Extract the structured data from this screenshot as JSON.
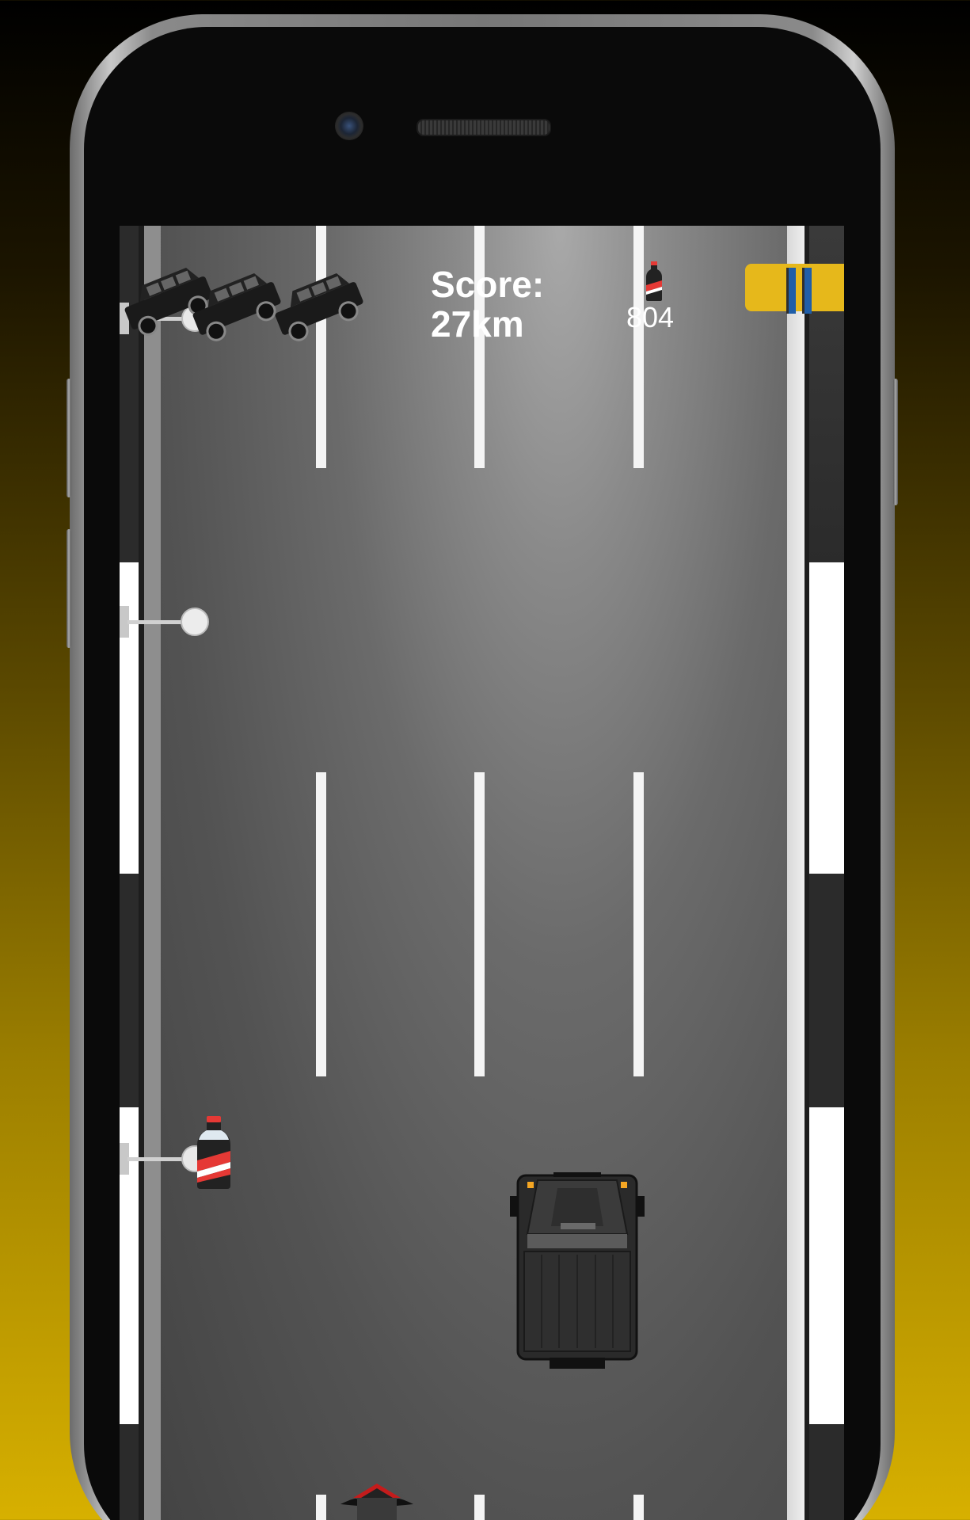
{
  "hud": {
    "score_label": "Score:",
    "score_value": "27km",
    "bottle_count": "804",
    "bottle_icon": "soda-bottle-icon",
    "pause_icon": "pause-icon",
    "lives": 3,
    "life_icon": "jeep-icon"
  },
  "colors": {
    "pause_button": "#e6b81b",
    "pause_bars": "#1f5ea8",
    "background_top": "#000000",
    "background_bottom": "#d7b000"
  }
}
